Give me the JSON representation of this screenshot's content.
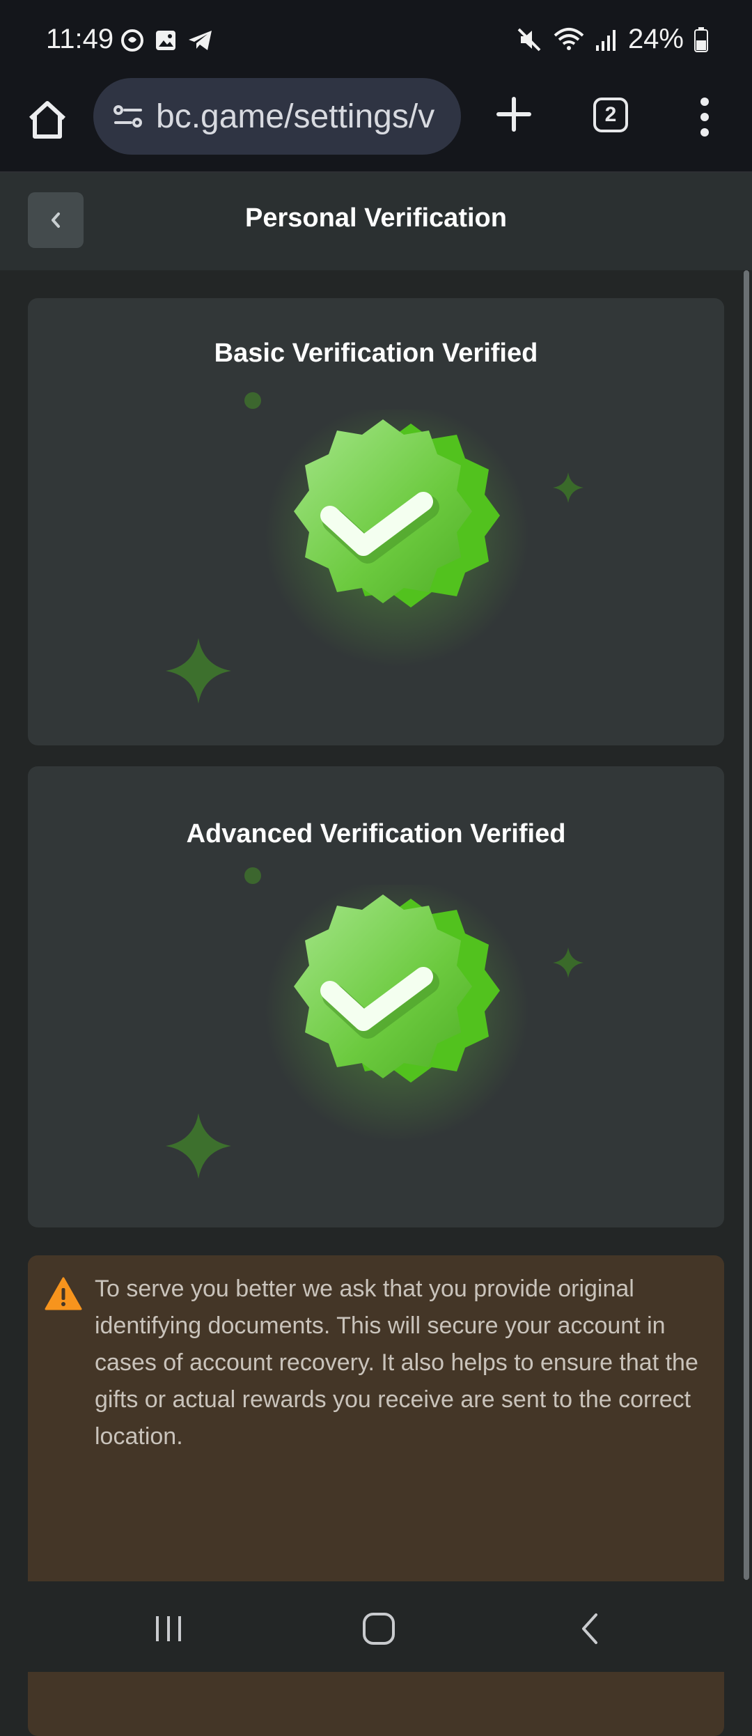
{
  "status_bar": {
    "time": "11:49",
    "battery": "24%"
  },
  "browser": {
    "url": "bc.game/settings/v",
    "tab_count": "2"
  },
  "page": {
    "title": "Personal Verification"
  },
  "cards": [
    {
      "title": "Basic Verification Verified"
    },
    {
      "title": "Advanced Verification Verified"
    }
  ],
  "notice": {
    "text": "To serve you better we ask that you provide original identifying documents. This will secure your account in cases of account recovery. It also helps to ensure that the gifts or actual rewards you receive are sent to the correct location."
  },
  "colors": {
    "accent_green": "#6fd83a",
    "warning_orange": "#f7941d",
    "card_bg": "#323738",
    "notice_bg": "#443627"
  }
}
